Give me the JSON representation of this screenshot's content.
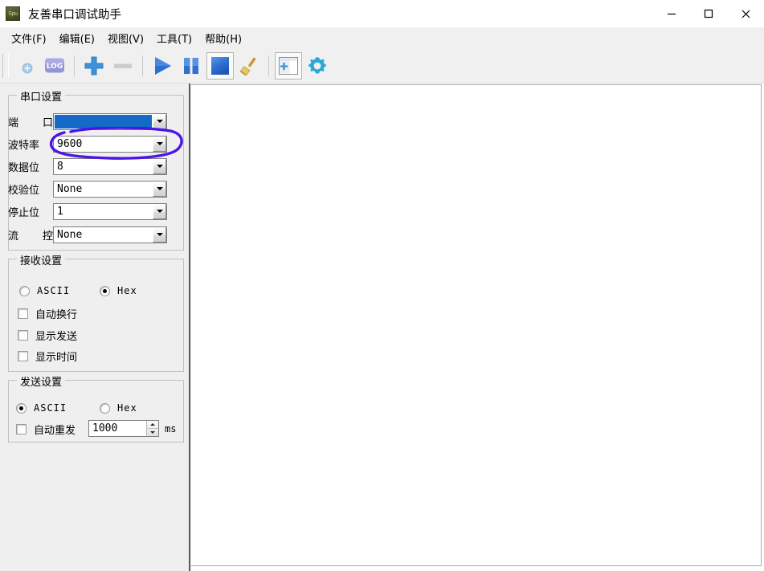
{
  "window": {
    "title": "友善串口调试助手",
    "icon_label": "Spu",
    "icon_name": "app-icon",
    "controls": [
      {
        "name": "minimize-button",
        "glyph": "minimize"
      },
      {
        "name": "maximize-button",
        "glyph": "maximize"
      },
      {
        "name": "close-button",
        "glyph": "close"
      }
    ]
  },
  "menubar": {
    "items": [
      {
        "label": "文件(F)",
        "name": "menu-file"
      },
      {
        "label": "编辑(E)",
        "name": "menu-edit"
      },
      {
        "label": "视图(V)",
        "name": "menu-view"
      },
      {
        "label": "工具(T)",
        "name": "menu-tools"
      },
      {
        "label": "帮助(H)",
        "name": "menu-help"
      }
    ]
  },
  "toolbar": {
    "buttons": [
      {
        "name": "add-connection-icon",
        "tooltip": "",
        "state": "disabled"
      },
      {
        "name": "log-icon",
        "tooltip": "LOG",
        "state": "normal"
      },
      {
        "name": "plus-icon",
        "tooltip": "",
        "state": "normal"
      },
      {
        "name": "minus-icon",
        "tooltip": "",
        "state": "disabled"
      },
      {
        "name": "play-icon",
        "tooltip": "",
        "state": "normal"
      },
      {
        "name": "pause-icon",
        "tooltip": "",
        "state": "normal"
      },
      {
        "name": "stop-icon",
        "tooltip": "",
        "state": "pressed"
      },
      {
        "name": "broom-clear-icon",
        "tooltip": "",
        "state": "normal"
      },
      {
        "name": "new-window-icon",
        "tooltip": "",
        "state": "normal"
      },
      {
        "name": "gear-settings-icon",
        "tooltip": "",
        "state": "normal"
      }
    ],
    "log_text": "LOG"
  },
  "serial_settings": {
    "title": "串口设置",
    "rows": [
      {
        "label_a": "端",
        "label_b": "口",
        "value": "",
        "name": "port-combobox",
        "selected": true
      },
      {
        "label_a": "波特率",
        "label_b": "",
        "value": "9600",
        "name": "baudrate-combobox",
        "selected": false
      },
      {
        "label_a": "数据位",
        "label_b": "",
        "value": "8",
        "name": "databits-combobox",
        "selected": false
      },
      {
        "label_a": "校验位",
        "label_b": "",
        "value": "None",
        "name": "parity-combobox",
        "selected": false
      },
      {
        "label_a": "停止位",
        "label_b": "",
        "value": "1",
        "name": "stopbits-combobox",
        "selected": false
      },
      {
        "label_a": "流",
        "label_b": "控",
        "value": "None",
        "name": "flowcontrol-combobox",
        "selected": false
      }
    ]
  },
  "receive_settings": {
    "title": "接收设置",
    "format_ascii": "ASCII",
    "format_hex": "Hex",
    "selected_format": "Hex",
    "checkboxes": [
      {
        "label": "自动换行",
        "checked": false,
        "name": "auto-wrap-checkbox"
      },
      {
        "label": "显示发送",
        "checked": false,
        "name": "show-send-checkbox"
      },
      {
        "label": "显示时间",
        "checked": false,
        "name": "show-time-checkbox"
      }
    ]
  },
  "send_settings": {
    "title": "发送设置",
    "format_ascii": "ASCII",
    "format_hex": "Hex",
    "selected_format": "ASCII",
    "auto_resend_label": "自动重发",
    "auto_resend_checked": false,
    "interval_value": "1000",
    "interval_unit": "ms"
  },
  "annotation": {
    "type": "hand-drawn-ellipse",
    "color": "#4c14e8",
    "target": "baudrate-combobox"
  },
  "colors": {
    "accent_blue": "#1569c7",
    "panel_bg": "#efefef",
    "toolbar_bg": "#f0f0f0",
    "annotation": "#4c14e8"
  }
}
